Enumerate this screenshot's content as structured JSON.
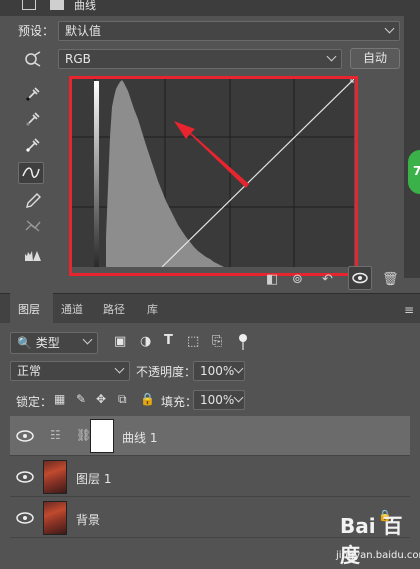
{
  "panel": {
    "title": "曲线",
    "preset_label": "预设：",
    "preset_value": "默认值",
    "channel_value": "RGB",
    "auto_label": "自动"
  },
  "tools": [
    "sample-icon",
    "eyedropper-black-icon",
    "eyedropper-gray-icon",
    "eyedropper-white-icon",
    "curve-point-icon",
    "pencil-icon",
    "smooth-icon",
    "histogram-warning-icon"
  ],
  "badge_value": "7",
  "layers_panel": {
    "tabs": [
      "图层",
      "通道",
      "路径",
      "库"
    ],
    "filter_value": "类型",
    "blend_mode": "正常",
    "opacity_label": "不透明度：",
    "opacity_value": "100%",
    "lock_label": "锁定：",
    "fill_label": "填充：",
    "fill_value": "100%",
    "layers": [
      {
        "name": "曲线 1",
        "selected": true
      },
      {
        "name": "图层 1",
        "selected": false
      },
      {
        "name": "背景",
        "selected": false
      }
    ]
  },
  "watermark": {
    "brand": "Bai 百度",
    "sub": "jingyan.baidu.com"
  },
  "colors": {
    "highlight": "#e8242e",
    "panel_bg": "#535353",
    "histogram_bg": "#3a3a3a"
  }
}
